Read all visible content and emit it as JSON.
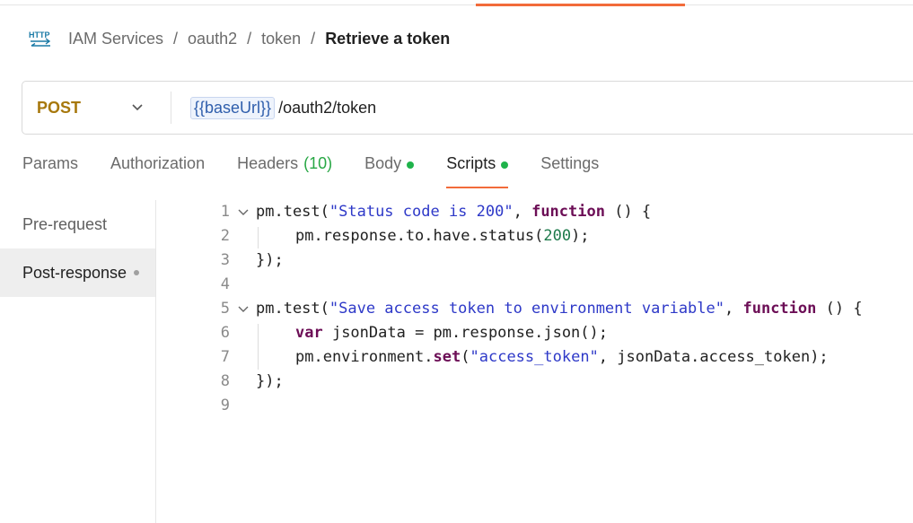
{
  "breadcrumb": {
    "icon": "http-icon",
    "items": [
      "IAM Services",
      "oauth2",
      "token"
    ],
    "current": "Retrieve a token"
  },
  "request": {
    "method": "POST",
    "url_variable": "{{baseUrl}}",
    "url_path": "/oauth2/token",
    "method_color": "#a7780d"
  },
  "tabs": [
    {
      "label": "Params"
    },
    {
      "label": "Authorization"
    },
    {
      "label": "Headers",
      "count": "(10)"
    },
    {
      "label": "Body",
      "dot": true
    },
    {
      "label": "Scripts",
      "dot": true,
      "active": true
    },
    {
      "label": "Settings"
    }
  ],
  "sidebar": {
    "items": [
      {
        "label": "Pre-request"
      },
      {
        "label": "Post-response",
        "active": true
      }
    ]
  },
  "editor": {
    "line_numbers": [
      "1",
      "2",
      "3",
      "4",
      "5",
      "6",
      "7",
      "8",
      "9"
    ],
    "lines": {
      "l1": {
        "a": "pm.test(",
        "b": "\"Status code is 200\"",
        "c": ", ",
        "d": "function",
        "e": " () {"
      },
      "l2": {
        "a": "pm.response.to.have.status(",
        "b": "200",
        "c": ");"
      },
      "l3": "});",
      "l5": {
        "a": "pm.test(",
        "b": "\"Save access token to environment variable\"",
        "c": ", ",
        "d": "function",
        "e": " () {"
      },
      "l6": {
        "a": "var",
        "b": " jsonData = pm.response.json();"
      },
      "l7": {
        "a": "pm.environment.",
        "b": "set",
        "c": "(",
        "d": "\"access_token\"",
        "e": ", jsonData.access_token);"
      },
      "l8": "});"
    }
  },
  "colors": {
    "accent": "#f26b3a",
    "success": "#1fb34b",
    "string": "#2e39c8",
    "keyword": "#6c0e56"
  }
}
